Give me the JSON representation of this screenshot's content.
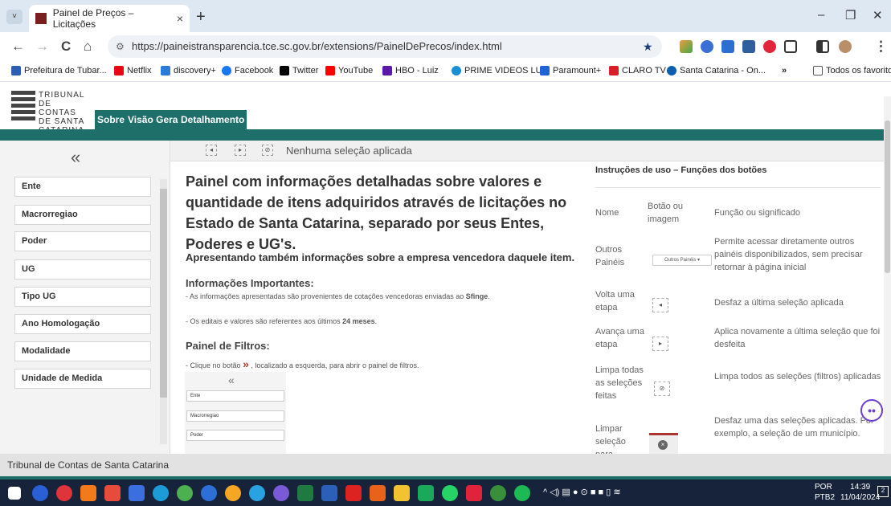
{
  "browser": {
    "tab_title": "Painel de Preços – Licitações",
    "tab_close": "×",
    "new_tab": "+",
    "url": "https://paineistransparencia.tce.sc.gov.br/extensions/PainelDePrecos/index.html",
    "window_controls": {
      "minimize": "–",
      "restore": "❐",
      "close": "✕"
    },
    "nav": {
      "back": "←",
      "forward": "→",
      "reload": "C",
      "home": "⌂"
    }
  },
  "bookmarks": [
    {
      "label": "Prefeitura de Tubar...",
      "color": "#2b5fb4"
    },
    {
      "label": "Netflix",
      "color": "#e50914"
    },
    {
      "label": "discovery+",
      "color": "#2d7bd8"
    },
    {
      "label": "Facebook",
      "color": "#1877f2"
    },
    {
      "label": "Twitter",
      "color": "#000000"
    },
    {
      "label": "YouTube",
      "color": "#ff0000"
    },
    {
      "label": "HBO - Luiz",
      "color": "#5b1aa8"
    },
    {
      "label": "PRIME VIDEOS LUIZ",
      "color": "#1b8fd6"
    },
    {
      "label": "Paramount+",
      "color": "#1f63d6"
    },
    {
      "label": "CLARO TV",
      "color": "#d81f26"
    },
    {
      "label": "Santa Catarina - On...",
      "color": "#0a5fae"
    }
  ],
  "bookmarks_more": "»",
  "bookmarks_all": "Todos os favoritos",
  "site": {
    "logo_text": [
      "TRIBUNAL",
      "DE CONTAS",
      "DE SANTA",
      "CATARINA"
    ],
    "tabs": [
      "Sobre",
      "Visão Geral",
      "Detalhamento"
    ]
  },
  "sidebar": {
    "collapse": "«",
    "filters": [
      "Ente",
      "Macrorregiao",
      "Poder",
      "UG",
      "Tipo UG",
      "Ano Homologação",
      "Modalidade",
      "Unidade de Medida"
    ]
  },
  "selection_bar": {
    "text": "Nenhuma seleção aplicada"
  },
  "main": {
    "heading": "Painel com informações detalhadas sobre valores e quantidade de itens adquiridos através de licitações no Estado de Santa Catarina, separado por seus Entes, Poderes e UG's.",
    "subheading": "Apresentando também informações sobre a empresa vencedora daquele item.",
    "info_title": "Informações Importantes:",
    "info_1_prefix": "- As informações apresentadas são provenientes de cotações vencedoras enviadas ao ",
    "info_1_bold": "Sfinge",
    "info_1_suffix": ".",
    "info_2_prefix": "- Os editais e valores são referentes aos últimos ",
    "info_2_bold": "24 meses",
    "info_2_suffix": ".",
    "filters_title": "Painel de Filtros:",
    "filters_note_prefix": "- Clique no botão",
    "filters_note_suffix": ", localizado a esquerda, para abrir o painel de filtros.",
    "mini_collapse": "«",
    "mini_filters": [
      "Ente",
      "Macrorregiao",
      "Poder"
    ]
  },
  "instructions": {
    "title": "Instruções de uso – Funções dos botões",
    "columns": [
      "Nome",
      "Botão ou imagem",
      "Função ou significado"
    ],
    "rows": [
      {
        "name": "Outros Painéis",
        "button": "Outros Painéis ▾",
        "function": "Permite acessar diretamente outros painéis disponibilizados, sem precisar retornar à página inicial"
      },
      {
        "name": "Volta uma etapa",
        "button": "",
        "function": "Desfaz a última seleção aplicada"
      },
      {
        "name": "Avança uma etapa",
        "button": "",
        "function": "Aplica novamente a última seleção que foi desfeita"
      },
      {
        "name": "Limpa todas as seleções feitas",
        "button": "",
        "function": "Limpa todos as seleções (filtros) aplicadas"
      },
      {
        "name": "Limpar seleção para",
        "button": "",
        "function": "Desfaz uma das seleções aplicadas. Por exemplo, a seleção de um município."
      }
    ]
  },
  "footer": {
    "text": "Tribunal de Contas de Santa Catarina"
  },
  "taskbar": {
    "lang": "POR",
    "lang2": "PTB2",
    "time": "14:39",
    "date": "11/04/2024"
  }
}
